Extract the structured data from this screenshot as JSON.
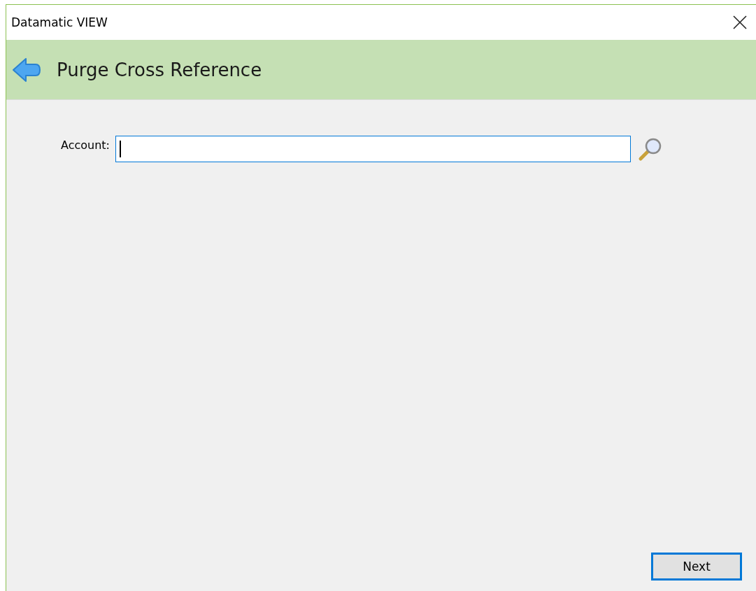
{
  "window": {
    "title": "Datamatic VIEW"
  },
  "header": {
    "title": "Purge Cross Reference"
  },
  "form": {
    "fields": [
      {
        "label": "Account:",
        "focused": true
      }
    ]
  },
  "buttons": [
    {
      "label": "Next",
      "default": true
    }
  ]
}
